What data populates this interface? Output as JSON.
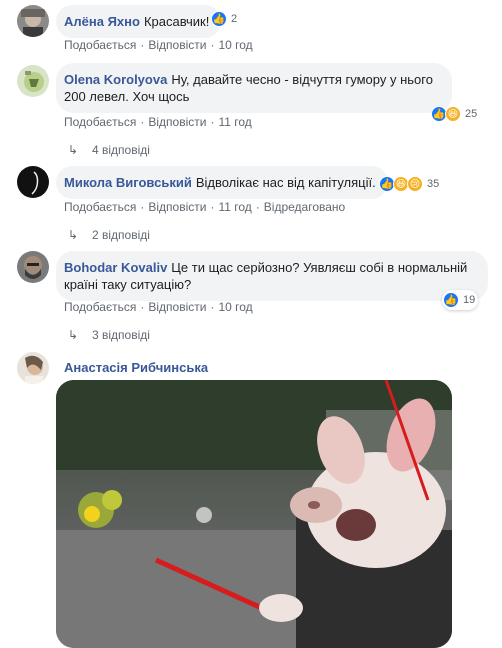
{
  "comments": [
    {
      "author": "Алёна Яхно",
      "text": "Красавчик!",
      "actions": [
        "Подобається",
        "Відповісти",
        "10 год"
      ],
      "reaction_count": "2"
    },
    {
      "author": "Olena Korolyova",
      "text": "Ну, давайте чесно - відчуття гумору у нього 200 левел. Хоч щось",
      "actions": [
        "Подобається",
        "Відповісти",
        "11 год"
      ],
      "reaction_count": "25",
      "replies": "4 відповіді"
    },
    {
      "author": "Микола Виговський",
      "text": "Відволікає нас від капітуляції.",
      "actions": [
        "Подобається",
        "Відповісти",
        "11 год",
        "Відредаговано"
      ],
      "reaction_count": "35",
      "replies": "2 відповіді"
    },
    {
      "author": "Bohodar Kovaliv",
      "text": "Це ти щас серйозно? Уявляєш собі в нормальній країні таку ситуацію?",
      "actions": [
        "Подобається",
        "Відповісти",
        "10 год"
      ],
      "reaction_count": "19",
      "replies": "3 відповіді"
    },
    {
      "author": "Анастасія Рибчинська"
    }
  ],
  "icons": {
    "reply": "reply-arrow-icon",
    "like": "like-reaction-icon",
    "haha": "haha-reaction-icon",
    "sad": "sad-reaction-icon"
  },
  "colors": {
    "author": "#385898",
    "bubble": "#f2f3f5",
    "meta": "#606770",
    "like": "#1877f2",
    "emoji": "#f7b125"
  }
}
